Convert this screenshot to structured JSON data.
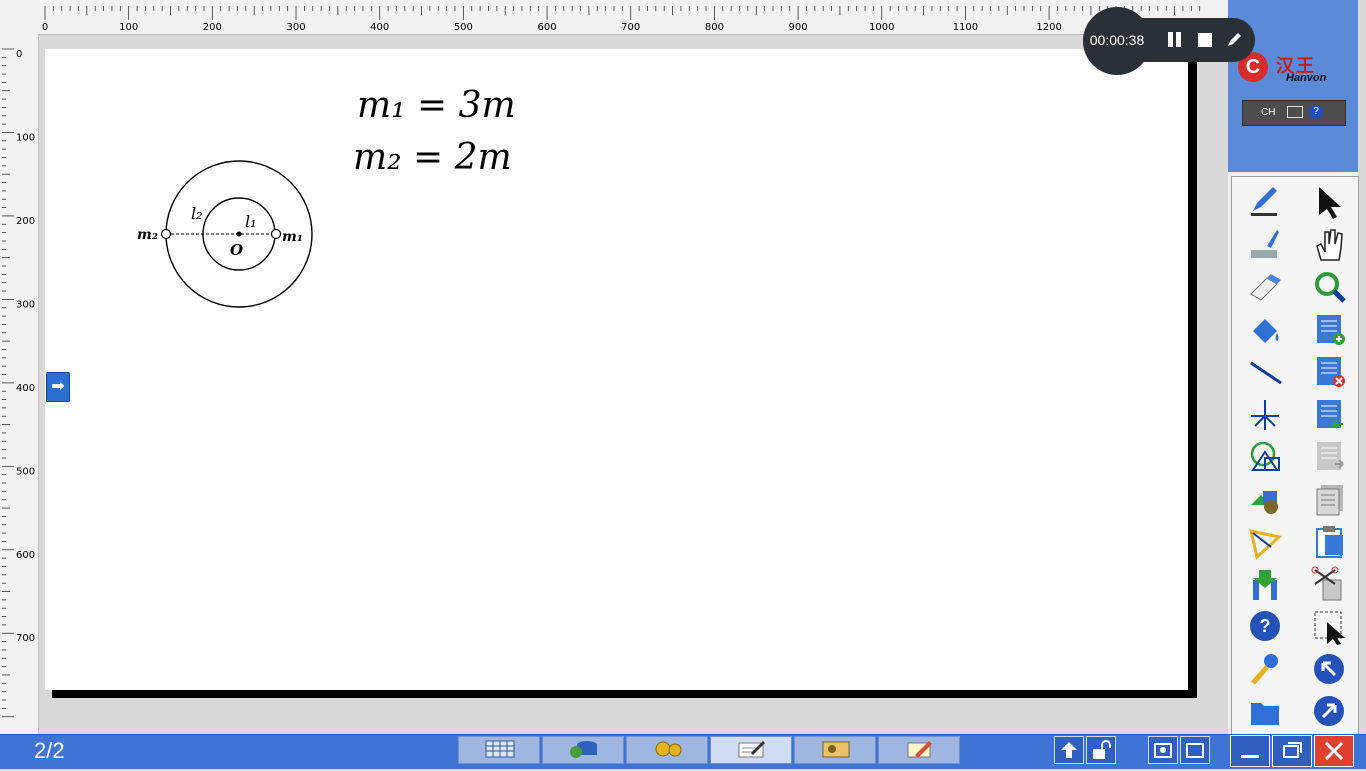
{
  "ruler_top": {
    "ticks": [
      "0",
      "100",
      "200",
      "300",
      "400",
      "500",
      "600",
      "700",
      "800",
      "900",
      "1000",
      "1100",
      "1200"
    ]
  },
  "ruler_left": {
    "ticks": [
      "0",
      "100",
      "200",
      "300",
      "400",
      "500",
      "600",
      "700"
    ]
  },
  "canvas": {
    "equation_1": "m₁ = 3m",
    "equation_2": "m₂ = 2m",
    "diagram": {
      "label_m2": "m₂",
      "label_m1": "m₁",
      "label_o": "O",
      "label_l2": "l₂",
      "label_l1": "l₁"
    }
  },
  "recording": {
    "elapsed": "00:00:38"
  },
  "logo": {
    "brand_cn": "汉王",
    "brand_en": "Hanvon"
  },
  "ime": {
    "mode": "CH",
    "help": "?"
  },
  "tools": [
    "pen-icon",
    "arrow-cursor-icon",
    "brush-icon",
    "hand-icon",
    "eraser-icon",
    "magnifier-icon",
    "fill-bucket-icon",
    "add-page-icon",
    "line-icon",
    "delete-page-icon",
    "axes-icon",
    "prev-page-icon",
    "shapes-icon",
    "next-page-icon",
    "3d-shapes-icon",
    "pages-icon",
    "protractor-icon",
    "clipboard-icon",
    "import-icon",
    "cut-icon",
    "help-icon",
    "select-icon",
    "settings-icon",
    "back-icon",
    "folder-icon",
    "forward-icon"
  ],
  "taskbar": {
    "page": "2/2",
    "buttons": [
      "grid-icon",
      "database-icon",
      "gear-icon",
      "write-icon",
      "film-icon",
      "edit-icon"
    ]
  },
  "colors": {
    "accent": "#3f73d4",
    "panel": "#5b8ad8",
    "close": "#e0402f"
  }
}
